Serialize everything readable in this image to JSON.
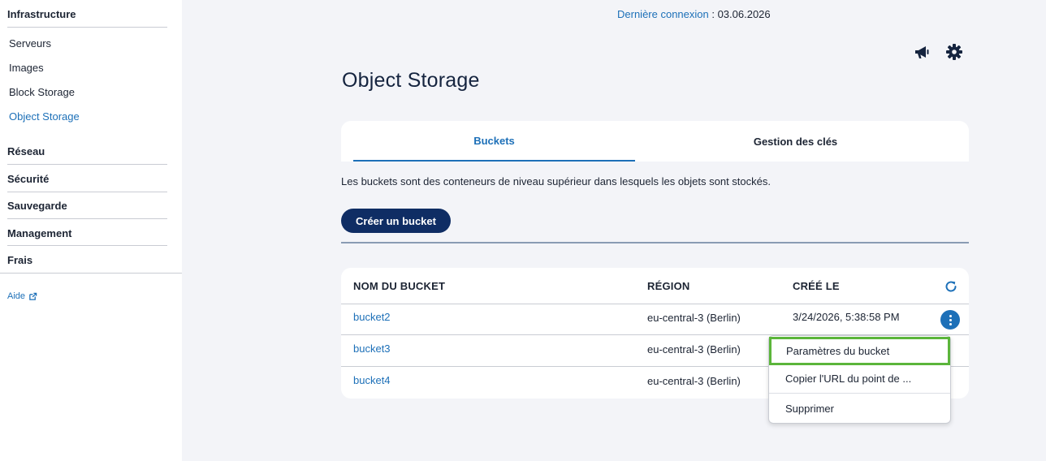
{
  "sidebar": {
    "infrastructure": "Infrastructure",
    "infra_items": [
      "Serveurs",
      "Images",
      "Block Storage",
      "Object Storage"
    ],
    "sections": [
      "Réseau",
      "Sécurité",
      "Sauvegarde",
      "Management",
      "Frais"
    ],
    "help": "Aide"
  },
  "header": {
    "last_login_label": "Dernière connexion",
    "last_login_sep": " : ",
    "last_login_value": "03.06.2026"
  },
  "page": {
    "title": "Object Storage",
    "tabs": [
      "Buckets",
      "Gestion des clés"
    ],
    "description": "Les buckets sont des conteneurs de niveau supérieur dans lesquels les objets sont stockés.",
    "create_button": "Créer un bucket"
  },
  "table": {
    "headers": [
      "NOM DU BUCKET",
      "RÉGION",
      "CRÉÉ LE"
    ],
    "rows": [
      {
        "name": "bucket2",
        "region": "eu-central-3 (Berlin)",
        "created": "3/24/2026, 5:38:58 PM"
      },
      {
        "name": "bucket3",
        "region": "eu-central-3 (Berlin)",
        "created": ""
      },
      {
        "name": "bucket4",
        "region": "eu-central-3 (Berlin)",
        "created": ""
      }
    ]
  },
  "menu": {
    "items": [
      "Paramètres du bucket",
      "Copier l'URL du point de ...",
      "Supprimer"
    ]
  },
  "colors": {
    "accent": "#1d70b8",
    "primary_button": "#0f2d64",
    "highlight": "#5bb53a"
  }
}
